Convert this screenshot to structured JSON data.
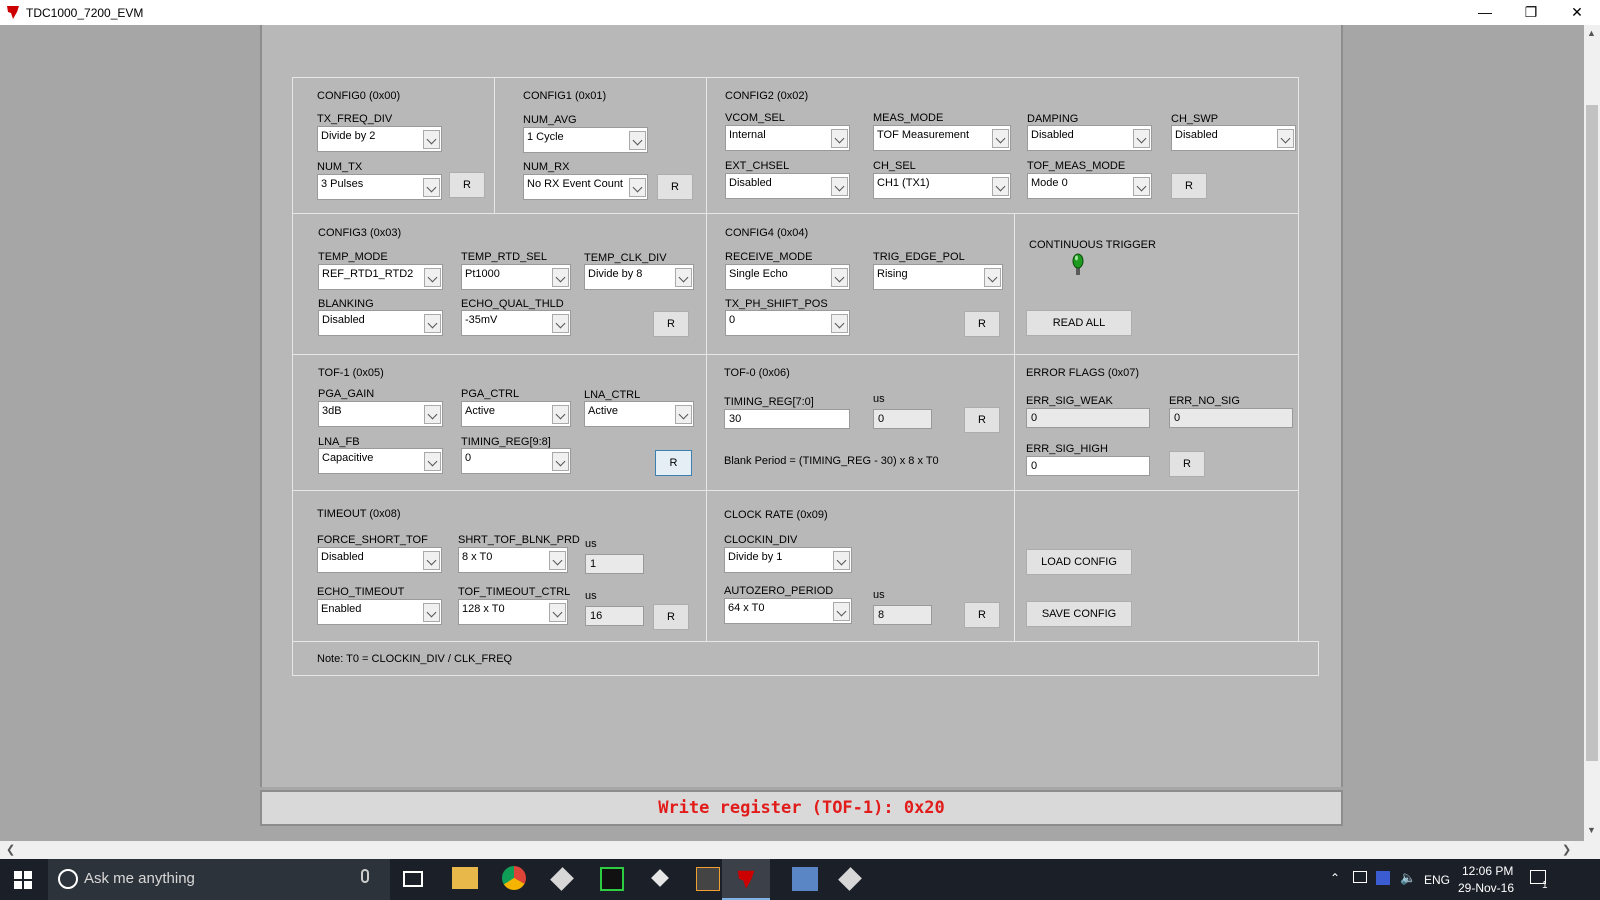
{
  "window": {
    "title": "TDC1000_7200_EVM",
    "brand_color": "#cc0000"
  },
  "config0": {
    "title": "CONFIG0 (0x00)",
    "tx_freq_div": {
      "label": "TX_FREQ_DIV",
      "value": "Divide by 2"
    },
    "num_tx": {
      "label": "NUM_TX",
      "value": "3 Pulses"
    },
    "read_label": "R"
  },
  "config1": {
    "title": "CONFIG1 (0x01)",
    "num_avg": {
      "label": "NUM_AVG",
      "value": "1 Cycle"
    },
    "num_rx": {
      "label": "NUM_RX",
      "value": "No RX Event Count"
    },
    "read_label": "R"
  },
  "config2": {
    "title": "CONFIG2 (0x02)",
    "vcom_sel": {
      "label": "VCOM_SEL",
      "value": "Internal"
    },
    "meas_mode": {
      "label": "MEAS_MODE",
      "value": "TOF Measurement"
    },
    "damping": {
      "label": "DAMPING",
      "value": "Disabled"
    },
    "ch_swp": {
      "label": "CH_SWP",
      "value": "Disabled"
    },
    "ext_chsel": {
      "label": "EXT_CHSEL",
      "value": "Disabled"
    },
    "ch_sel": {
      "label": "CH_SEL",
      "value": "CH1 (TX1)"
    },
    "tof_meas_mode": {
      "label": "TOF_MEAS_MODE",
      "value": "Mode 0"
    },
    "read_label": "R"
  },
  "config3": {
    "title": "CONFIG3 (0x03)",
    "temp_mode": {
      "label": "TEMP_MODE",
      "value": "REF_RTD1_RTD2"
    },
    "temp_rtd_sel": {
      "label": "TEMP_RTD_SEL",
      "value": "Pt1000"
    },
    "temp_clk_div": {
      "label": "TEMP_CLK_DIV",
      "value": "Divide by 8"
    },
    "blanking": {
      "label": "BLANKING",
      "value": "Disabled"
    },
    "echo_qual_thld": {
      "label": "ECHO_QUAL_THLD",
      "value": "-35mV"
    },
    "read_label": "R"
  },
  "config4": {
    "title": "CONFIG4 (0x04)",
    "receive_mode": {
      "label": "RECEIVE_MODE",
      "value": "Single Echo"
    },
    "trig_edge_pol": {
      "label": "TRIG_EDGE_POL",
      "value": "Rising"
    },
    "tx_ph_shift_pos": {
      "label": "TX_PH_SHIFT_POS",
      "value": "0"
    },
    "read_label": "R"
  },
  "trigger": {
    "label": "CONTINUOUS TRIGGER",
    "led_color": "#1e9a1e",
    "read_all_label": "READ ALL"
  },
  "tof1": {
    "title": "TOF-1 (0x05)",
    "pga_gain": {
      "label": "PGA_GAIN",
      "value": "3dB"
    },
    "pga_ctrl": {
      "label": "PGA_CTRL",
      "value": "Active"
    },
    "lna_ctrl": {
      "label": "LNA_CTRL",
      "value": "Active"
    },
    "lna_fb": {
      "label": "LNA_FB",
      "value": "Capacitive"
    },
    "timing_reg_hi": {
      "label": "TIMING_REG[9:8]",
      "value": "0"
    },
    "read_label": "R"
  },
  "tof0": {
    "title": "TOF-0 (0x06)",
    "timing_reg_lo": {
      "label": "TIMING_REG[7:0]",
      "value": "30"
    },
    "us_label": "us",
    "us_value": "0",
    "formula": "Blank Period = (TIMING_REG - 30) x 8 x T0",
    "read_label": "R"
  },
  "error_flags": {
    "title": "ERROR FLAGS (0x07)",
    "err_sig_weak": {
      "label": "ERR_SIG_WEAK",
      "value": "0"
    },
    "err_no_sig": {
      "label": "ERR_NO_SIG",
      "value": "0"
    },
    "err_sig_high": {
      "label": "ERR_SIG_HIGH",
      "value": "0"
    },
    "read_label": "R"
  },
  "timeout": {
    "title": "TIMEOUT (0x08)",
    "force_short_tof": {
      "label": "FORCE_SHORT_TOF",
      "value": "Disabled"
    },
    "shrt_tof_blnk_prd": {
      "label": "SHRT_TOF_BLNK_PRD",
      "value": "8 x T0"
    },
    "us1_label": "us",
    "us1_value": "1",
    "echo_timeout": {
      "label": "ECHO_TIMEOUT",
      "value": "Enabled"
    },
    "tof_timeout_ctrl": {
      "label": "TOF_TIMEOUT_CTRL",
      "value": "128 x T0"
    },
    "us2_label": "us",
    "us2_value": "16",
    "read_label": "R"
  },
  "clock_rate": {
    "title": "CLOCK RATE (0x09)",
    "clockin_div": {
      "label": "CLOCKIN_DIV",
      "value": "Divide by 1"
    },
    "autozero_period": {
      "label": "AUTOZERO_PERIOD",
      "value": "64 x T0"
    },
    "us_label": "us",
    "us_value": "8",
    "read_label": "R"
  },
  "config_buttons": {
    "load": "LOAD CONFIG",
    "save": "SAVE CONFIG"
  },
  "note": "Note: T0 = CLOCKIN_DIV / CLK_FREQ",
  "status": {
    "message": "Write register (TOF-1): 0x20",
    "color": "#e21b1b"
  },
  "taskbar": {
    "search_placeholder": "Ask me anything",
    "language": "ENG",
    "time": "12:06 PM",
    "date": "29-Nov-16",
    "notification_count": "1"
  }
}
